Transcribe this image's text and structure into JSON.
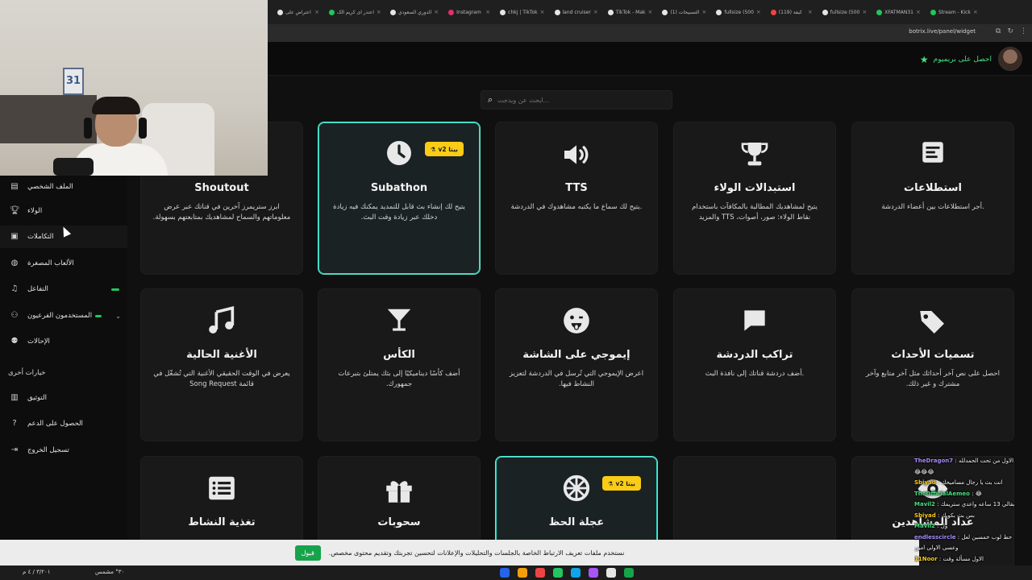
{
  "browser": {
    "tabs": [
      {
        "label": "اعتراض علی",
        "color": "#e5e5e5"
      },
      {
        "label": "اعتذر ای کریم الک",
        "color": "#22c55e"
      },
      {
        "label": "الدوري السعودي",
        "color": "#e5e5e5"
      },
      {
        "label": "Instagram",
        "color": "#e1306c"
      },
      {
        "label": "chkj | TikTok",
        "color": "#e5e5e5"
      },
      {
        "label": "land cruiser",
        "color": "#e5e5e5"
      },
      {
        "label": "TikTok - Mak",
        "color": "#e5e5e5"
      },
      {
        "label": "(1) التسبيحات",
        "color": "#e5e5e5"
      },
      {
        "label": "fullsize (500",
        "color": "#e5e5e5"
      },
      {
        "label": "(119) كيفة",
        "color": "#ef4444"
      },
      {
        "label": "fullsize (500",
        "color": "#e5e5e5"
      },
      {
        "label": "XFATMAN31",
        "color": "#22c55e"
      },
      {
        "label": "Stream - Kick",
        "color": "#22c55e"
      }
    ],
    "url": "botrix.live/panel/widget"
  },
  "header": {
    "premium_label": "احصل على بريميوم"
  },
  "webcam": {
    "frame_number": "31"
  },
  "sidebar": {
    "items": [
      {
        "label": "الملف الشخصي",
        "icon": "card-icon"
      },
      {
        "label": "الولاء",
        "icon": "trophy-icon"
      },
      {
        "label": "التكاملات",
        "icon": "plug-icon"
      },
      {
        "label": "الألعاب المصغرة",
        "icon": "gamepad-icon"
      },
      {
        "label": "التفاعل",
        "icon": "music-icon"
      },
      {
        "label": "المستخدمون الفرعيون",
        "icon": "users-icon"
      },
      {
        "label": "الإحالات",
        "icon": "user-plus-icon"
      }
    ],
    "other_options_title": "خيارات أخرى",
    "other_items": [
      {
        "label": "التوثيق",
        "icon": "doc-icon"
      },
      {
        "label": "الحصول على الدعم",
        "icon": "help-icon"
      },
      {
        "label": "تسجيل الخروج",
        "icon": "logout-icon"
      }
    ]
  },
  "search": {
    "placeholder": "...ابحث عن ويدجت"
  },
  "badge_label": "v2 بيتا",
  "cards": [
    {
      "title": "استطلاعات",
      "desc": ".أجر استطلاعات بين أعضاء الدردشة",
      "icon": "poll-icon",
      "active": false
    },
    {
      "title": "استبدالات الولاء",
      "desc": "يتيح لمشاهديك المطالبة بالمكافآت باستخدام نقاط الولاء: صور، أصوات، TTS والمزيد",
      "icon": "trophy-icon",
      "active": false
    },
    {
      "title": "TTS",
      "desc": ".يتيح لك سماع ما يكتبه مشاهدوك في الدردشة",
      "icon": "speaker-icon",
      "active": false
    },
    {
      "title": "Subathon",
      "desc": "يتيح لك إنشاء بث قابل للتمديد يمكنك فيه زيادة دخلك عبر زيادة وقت البث.",
      "icon": "clock-icon",
      "active": true,
      "badge": true
    },
    {
      "title": "Shoutout",
      "desc": "ابرز ستريمرز آخرين في قناتك عبر عرض معلوماتهم والسماح لمشاهديك بمتابعتهم بسهولة.",
      "icon": "none",
      "active": false
    },
    {
      "title": "تسميات الأحداث",
      "desc": "احصل على نص آخر أحداثك مثل آخر متابع وآخر مشترك و غير ذلك.",
      "icon": "tags-icon",
      "active": false
    },
    {
      "title": "تراكب الدردشة",
      "desc": ".أضف دردشة قناتك إلى نافذة البث",
      "icon": "chat-bubble-icon",
      "active": false
    },
    {
      "title": "إيموجي على الشاشة",
      "desc": "اعرض الإيموجي التي تُرسل في الدردشة لتعزيز النشاط فيها.",
      "icon": "emoji-icon",
      "active": false
    },
    {
      "title": "الكأس",
      "desc": "أضف كأسًا ديناميكيًا إلى بثك يمتلئ بتبرعات جمهورك.",
      "icon": "cocktail-icon",
      "active": false
    },
    {
      "title": "الأغنية الحالية",
      "desc": "يعرض في الوقت الحقيقي الأغنية التي تُشغّل في قائمة Song Request",
      "icon": "music-note-icon",
      "active": false
    },
    {
      "title": "عداد المشاهدين",
      "desc": "",
      "icon": "eye-icon",
      "active": false
    },
    {
      "title": "",
      "desc": "",
      "icon": "none",
      "active": false
    },
    {
      "title": "عجلة الحظ",
      "desc": "",
      "icon": "wheel-icon",
      "active": true,
      "badge": true
    },
    {
      "title": "سحوبات",
      "desc": "",
      "icon": "gift-icon",
      "active": false
    },
    {
      "title": "تغذية النشاط",
      "desc": "",
      "icon": "list-icon",
      "active": false
    }
  ],
  "cookie": {
    "text": "نستخدم ملفات تعريف الارتباط الخاصة بالجلسات والتحليلات والإعلانات لتحسين تجربتك وتقديم محتوى مخصص.",
    "accept_label": "قبول"
  },
  "chat": [
    {
      "user": "TheDragon7",
      "text": ": الاول من تحت الحمدلله",
      "color": "#a78bfa"
    },
    {
      "user": "",
      "text": "😂😂😂",
      "color": "#f2f2f2"
    },
    {
      "user": "Sbiyad",
      "text": ": انت بث يا رجال مساميحك",
      "color": "#facc15"
    },
    {
      "user": "TheOfficialAemeo",
      "text": ": 😂",
      "color": "#4ade80"
    },
    {
      "user": "Mavil2",
      "text": ": بقالي 13 ساعه واعدي ستريمك",
      "color": "#4ade80"
    },
    {
      "user": "Sbiyad",
      "text": ": بس بث بكويك",
      "color": "#facc15"
    },
    {
      "user": "Mavil2",
      "text": ": ول",
      "color": "#4ade80"
    },
    {
      "user": "endlesscircle",
      "text": ": حط لوب خمسين لعل",
      "color": "#a78bfa"
    },
    {
      "user": "",
      "text": "وعسى الاولى امين",
      "color": "#f2f2f2"
    },
    {
      "user": "11Noor",
      "text": ": الاول مسألة وقت",
      "color": "#facc15"
    }
  ],
  "taskbar": {
    "clock": "٣/٢٠١ / ٤ م",
    "weather": "٣٠° مشمس"
  }
}
